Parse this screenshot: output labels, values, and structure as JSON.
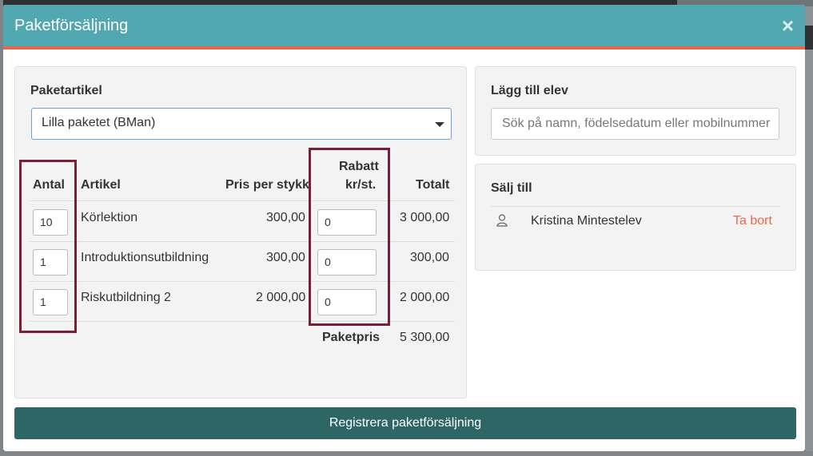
{
  "modal": {
    "title": "Paketförsäljning",
    "close_glyph": "×"
  },
  "package": {
    "label": "Paketartikel",
    "selected": "Lilla paketet (BMan)"
  },
  "table": {
    "headers": {
      "qty": "Antal",
      "article": "Artikel",
      "price": "Pris per stykk",
      "discount_line1": "Rabatt",
      "discount_line2": "kr/st.",
      "total": "Totalt"
    },
    "rows": [
      {
        "qty": "10",
        "article": "Körlektion",
        "price": "300,00",
        "discount": "0",
        "total": "3 000,00"
      },
      {
        "qty": "1",
        "article": "Introduktionsutbildning",
        "price": "300,00",
        "discount": "0",
        "total": "300,00"
      },
      {
        "qty": "1",
        "article": "Riskutbildning 2",
        "price": "2 000,00",
        "discount": "0",
        "total": "2 000,00"
      }
    ],
    "package_price_label": "Paketpris",
    "package_price_value": "5 300,00"
  },
  "add_student": {
    "label": "Lägg till elev",
    "placeholder": "Sök på namn, födelsedatum eller mobilnummer"
  },
  "sell_to": {
    "label": "Sälj till",
    "buyer": "Kristina Mintestelev",
    "remove_label": "Ta bort",
    "icon": "user-icon"
  },
  "register_label": "Registrera paketförsäljning",
  "colors": {
    "header": "#52a8b0",
    "accent": "#e8694a",
    "button": "#2e6666",
    "highlight": "#7a1f35"
  }
}
